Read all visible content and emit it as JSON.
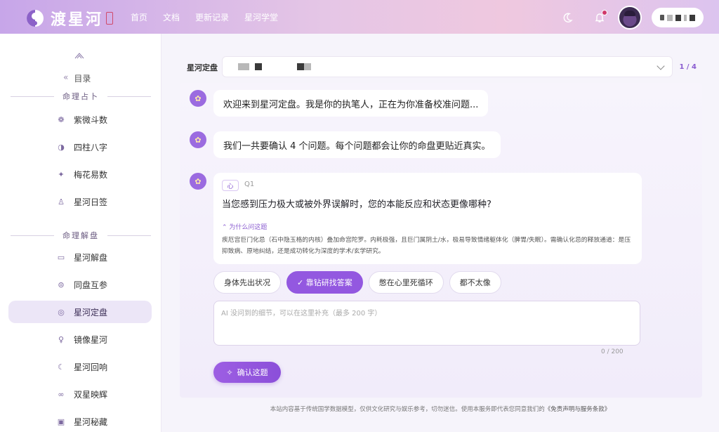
{
  "header": {
    "logo_text": "渡星河",
    "nav": [
      "首页",
      "文档",
      "更新记录",
      "星河学堂"
    ]
  },
  "sidebar": {
    "toc_label": "目录",
    "toc_chevron": "«",
    "section1": "命理占卜",
    "section2": "命理解盘",
    "items": [
      {
        "label": "紫微斗数",
        "icon": "ziwei-icon"
      },
      {
        "label": "四柱八字",
        "icon": "bazi-icon"
      },
      {
        "label": "梅花易数",
        "icon": "meihua-icon"
      },
      {
        "label": "星河日签",
        "icon": "daily-sign-icon"
      },
      {
        "label": "星河解盘",
        "icon": "chat-icon"
      },
      {
        "label": "同盘互参",
        "icon": "compare-icon"
      },
      {
        "label": "星河定盘",
        "icon": "target-icon",
        "active": true
      },
      {
        "label": "镜像星河",
        "icon": "mirror-icon"
      },
      {
        "label": "星河回响",
        "icon": "echo-icon"
      },
      {
        "label": "双星映辉",
        "icon": "twin-stars-icon"
      },
      {
        "label": "星河秘藏",
        "icon": "treasure-icon"
      }
    ]
  },
  "calibration": {
    "label": "星河定盘",
    "count": "1 / 4"
  },
  "messages": [
    "欢迎来到星河定盘。我是你的执笔人，正在为你准备校准问题...",
    "我们一共要确认 4 个问题。每个问题都会让你的命盘更贴近真实。"
  ],
  "question": {
    "tag": "心",
    "number": "Q1",
    "text": "当您感到压力极大或被外界误解时，您的本能反应和状态更像哪种?",
    "why_label": "⌃ 为什么问这题",
    "why_text": "疾厄宫巨门化忌（石中隐玉格的内核）叠加命宫陀罗。内耗极强，且巨门属阴土/水，极易导致情绪躯体化（脾胃/失眠）。需确认化忌的释放通道：是压抑致病、原地纠结，还是成功转化为深度的学术/玄学研究。"
  },
  "options": [
    {
      "label": "身体先出状况",
      "selected": false
    },
    {
      "label": "✓ 靠钻研找答案",
      "selected": true
    },
    {
      "label": "憋在心里死循环",
      "selected": false
    },
    {
      "label": "都不太像",
      "selected": false
    }
  ],
  "note": {
    "placeholder": "AI 没问到的细节，可以在这里补充（最多 200 字）",
    "value": "",
    "count": "0 / 200"
  },
  "confirm_label": "确认这题",
  "footer": {
    "text": "本站内容基于传统国学数据模型，仅供文化研究与娱乐参考，切勿迷信。使用本服务即代表您同意我们的",
    "link": "《免责声明与服务条款》"
  }
}
